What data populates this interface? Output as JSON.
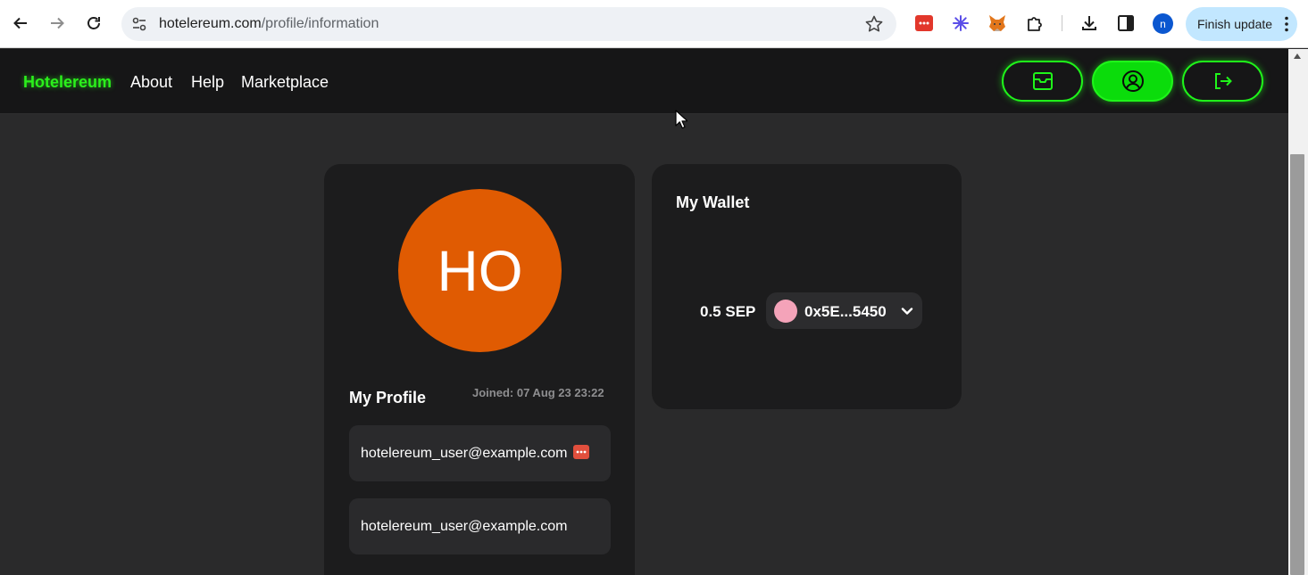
{
  "browser": {
    "url_host": "hotelereum.com",
    "url_path": "/profile/information",
    "profile_initial": "n",
    "finish_update_label": "Finish update"
  },
  "site": {
    "brand": "Hotelereum",
    "nav": [
      "About",
      "Help",
      "Marketplace"
    ],
    "accent_color": "#1ff51a"
  },
  "profile": {
    "avatar_initials": "HO",
    "avatar_color": "#e05b02",
    "title": "My Profile",
    "joined": "Joined: 07 Aug 23 23:22",
    "fields": [
      "hotelereum_user@example.com",
      "hotelereum_user@example.com"
    ]
  },
  "wallet": {
    "title": "My Wallet",
    "balance": "0.5 SEP",
    "address": "0x5E...5450"
  },
  "icons": {
    "header_buttons": [
      "inbox-icon",
      "user-circle-icon",
      "logout-icon"
    ]
  }
}
